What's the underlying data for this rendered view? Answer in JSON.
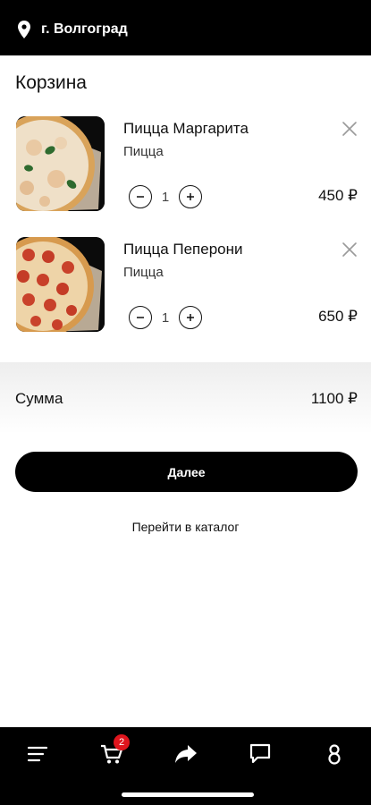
{
  "header": {
    "city": "г. Волгоград"
  },
  "cart": {
    "title": "Корзина",
    "items": [
      {
        "name": "Пицца Маргарита",
        "category": "Пицца",
        "qty": "1",
        "price": "450 ₽"
      },
      {
        "name": "Пицца Пеперони",
        "category": "Пицца",
        "qty": "1",
        "price": "650 ₽"
      }
    ],
    "sum_label": "Сумма",
    "sum_value": "1100 ₽",
    "next_label": "Далее",
    "catalog_link": "Перейти в каталог"
  },
  "tabbar": {
    "items": [
      "menu-icon",
      "cart-icon",
      "share-icon",
      "chat-icon",
      "profile-icon"
    ],
    "cart_badge": "2"
  },
  "colors": {
    "accent": "#000000",
    "badge": "#e0151d",
    "background": "#ffffff"
  }
}
